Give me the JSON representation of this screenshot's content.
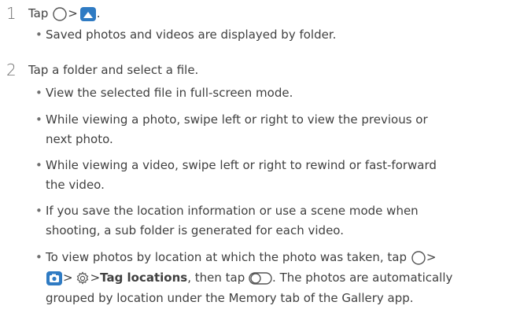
{
  "steps": [
    {
      "number": "1",
      "text_before": "Tap",
      "sep": ">",
      "end": ".",
      "icons": [
        "home-circle-icon",
        "gallery-icon"
      ],
      "bullets": [
        {
          "lines": [
            "Saved photos and videos are displayed by folder."
          ]
        }
      ]
    },
    {
      "number": "2",
      "text": "Tap a folder and select a file.",
      "bullets": [
        {
          "lines": [
            "View the selected file in full-screen mode."
          ]
        },
        {
          "lines": [
            "While viewing a photo, swipe left or right to view the previous or",
            "next photo."
          ]
        },
        {
          "lines": [
            "While viewing a video, swipe left or right to rewind or fast-forward",
            "the video."
          ]
        },
        {
          "lines": [
            "If you save the location information or use a scene mode when",
            "shooting, a sub folder is generated for each video."
          ]
        }
      ],
      "last_bullet": {
        "l1_text": "To view photos by location at which the photo was taken, tap",
        "l1_sep": ">",
        "l2_sep1": ">",
        "l2_sep2": ">",
        "l2_bold": "Tag locations",
        "l2_after": ", then tap",
        "l2_end": ". The photos are automatically",
        "l3_text": "grouped by location under the Memory tab of the Gallery app."
      }
    }
  ],
  "colors": {
    "text": "#404040",
    "step_number": "#707070",
    "icon_blue": "#2f7bc3",
    "icon_gray": "#555555"
  }
}
